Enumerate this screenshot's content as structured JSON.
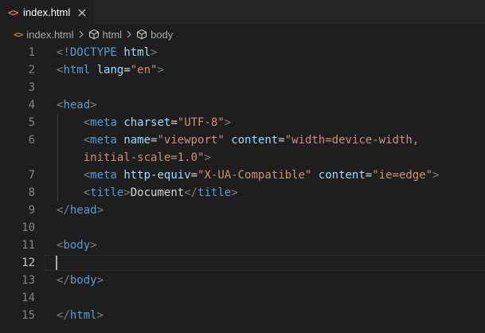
{
  "tab": {
    "file_icon": "<>",
    "label": "index.html",
    "close_icon": "close-icon"
  },
  "breadcrumb": {
    "html_icon": "<>",
    "items": [
      "index.html",
      "html",
      "body"
    ]
  },
  "editor": {
    "active_line": 12,
    "lines": [
      {
        "number": "1",
        "tokens": [
          {
            "t": "<!",
            "c": "bracket"
          },
          {
            "t": "DOCTYPE",
            "c": "tag"
          },
          {
            "t": " ",
            "c": "text"
          },
          {
            "t": "html",
            "c": "attr"
          },
          {
            "t": ">",
            "c": "bracket"
          }
        ]
      },
      {
        "number": "2",
        "tokens": [
          {
            "t": "<",
            "c": "bracket"
          },
          {
            "t": "html",
            "c": "tag"
          },
          {
            "t": " ",
            "c": "text"
          },
          {
            "t": "lang",
            "c": "attr"
          },
          {
            "t": "=",
            "c": "text"
          },
          {
            "t": "\"en\"",
            "c": "str"
          },
          {
            "t": ">",
            "c": "bracket"
          }
        ]
      },
      {
        "number": "3",
        "tokens": []
      },
      {
        "number": "4",
        "tokens": [
          {
            "t": "<",
            "c": "bracket"
          },
          {
            "t": "head",
            "c": "tag"
          },
          {
            "t": ">",
            "c": "bracket"
          }
        ]
      },
      {
        "number": "5",
        "tokens": [
          {
            "t": "    ",
            "c": "text"
          },
          {
            "t": "<",
            "c": "bracket"
          },
          {
            "t": "meta",
            "c": "tag"
          },
          {
            "t": " ",
            "c": "text"
          },
          {
            "t": "charset",
            "c": "attr"
          },
          {
            "t": "=",
            "c": "text"
          },
          {
            "t": "\"UTF-8\"",
            "c": "str"
          },
          {
            "t": ">",
            "c": "bracket"
          }
        ]
      },
      {
        "number": "6",
        "tokens": [
          {
            "t": "    ",
            "c": "text"
          },
          {
            "t": "<",
            "c": "bracket"
          },
          {
            "t": "meta",
            "c": "tag"
          },
          {
            "t": " ",
            "c": "text"
          },
          {
            "t": "name",
            "c": "attr"
          },
          {
            "t": "=",
            "c": "text"
          },
          {
            "t": "\"viewport\"",
            "c": "str"
          },
          {
            "t": " ",
            "c": "text"
          },
          {
            "t": "content",
            "c": "attr"
          },
          {
            "t": "=",
            "c": "text"
          },
          {
            "t": "\"width=device-width,",
            "c": "str"
          }
        ]
      },
      {
        "number": "",
        "tokens": [
          {
            "t": "    ",
            "c": "text"
          },
          {
            "t": "initial-scale=1.0\"",
            "c": "str"
          },
          {
            "t": ">",
            "c": "bracket"
          }
        ]
      },
      {
        "number": "7",
        "tokens": [
          {
            "t": "    ",
            "c": "text"
          },
          {
            "t": "<",
            "c": "bracket"
          },
          {
            "t": "meta",
            "c": "tag"
          },
          {
            "t": " ",
            "c": "text"
          },
          {
            "t": "http-equiv",
            "c": "attr"
          },
          {
            "t": "=",
            "c": "text"
          },
          {
            "t": "\"X-UA-Compatible\"",
            "c": "str"
          },
          {
            "t": " ",
            "c": "text"
          },
          {
            "t": "content",
            "c": "attr"
          },
          {
            "t": "=",
            "c": "text"
          },
          {
            "t": "\"ie=edge\"",
            "c": "str"
          },
          {
            "t": ">",
            "c": "bracket"
          }
        ]
      },
      {
        "number": "8",
        "tokens": [
          {
            "t": "    ",
            "c": "text"
          },
          {
            "t": "<",
            "c": "bracket"
          },
          {
            "t": "title",
            "c": "tag"
          },
          {
            "t": ">",
            "c": "bracket"
          },
          {
            "t": "Document",
            "c": "text"
          },
          {
            "t": "</",
            "c": "bracket"
          },
          {
            "t": "title",
            "c": "tag"
          },
          {
            "t": ">",
            "c": "bracket"
          }
        ]
      },
      {
        "number": "9",
        "tokens": [
          {
            "t": "</",
            "c": "bracket"
          },
          {
            "t": "head",
            "c": "tag"
          },
          {
            "t": ">",
            "c": "bracket"
          }
        ]
      },
      {
        "number": "10",
        "tokens": []
      },
      {
        "number": "11",
        "tokens": [
          {
            "t": "<",
            "c": "bracket"
          },
          {
            "t": "body",
            "c": "tag"
          },
          {
            "t": ">",
            "c": "bracket"
          }
        ]
      },
      {
        "number": "12",
        "tokens": []
      },
      {
        "number": "13",
        "tokens": [
          {
            "t": "</",
            "c": "bracket"
          },
          {
            "t": "body",
            "c": "tag"
          },
          {
            "t": ">",
            "c": "bracket"
          }
        ]
      },
      {
        "number": "14",
        "tokens": []
      },
      {
        "number": "15",
        "tokens": [
          {
            "t": "</",
            "c": "bracket"
          },
          {
            "t": "html",
            "c": "tag"
          },
          {
            "t": ">",
            "c": "bracket"
          }
        ]
      }
    ]
  }
}
